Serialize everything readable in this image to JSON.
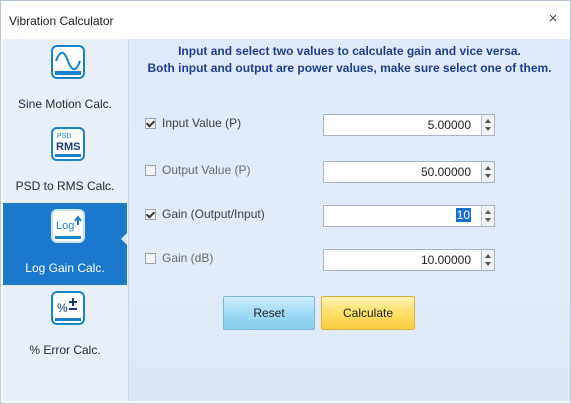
{
  "window": {
    "title": "Vibration Calculator",
    "close_glyph": "×"
  },
  "sidebar": {
    "items": [
      {
        "label": "Sine Motion Calc.",
        "icon": "sine-wave-icon",
        "active": false
      },
      {
        "label": "PSD to RMS Calc.",
        "icon": "psd-rms-icon",
        "active": false,
        "icon_text_top": "PSD",
        "icon_text_main": "RMS"
      },
      {
        "label": "Log Gain Calc.",
        "icon": "log-gain-icon",
        "active": true,
        "icon_text_main": "Log"
      },
      {
        "label": "% Error Calc.",
        "icon": "percent-error-icon",
        "active": false,
        "icon_text_main": "%"
      }
    ]
  },
  "main": {
    "header_line1": "Input and select two values to calculate gain and vice versa.",
    "header_line2": "Both input and output are power values, make sure select one of them.",
    "fields": [
      {
        "label": "Input Value (P)",
        "checked": true,
        "value": "5.00000"
      },
      {
        "label": "Output Value (P)",
        "checked": false,
        "value": "50.00000"
      },
      {
        "label": "Gain (Output/Input)",
        "checked": true,
        "value": "10"
      },
      {
        "label": "Gain (dB)",
        "checked": false,
        "value": "10.00000"
      }
    ],
    "buttons": {
      "reset": "Reset",
      "calculate": "Calculate"
    }
  },
  "colors": {
    "accent": "#1c78cc",
    "sidebar_bg": "#e7f0fb",
    "main_bg": "#dfeafa",
    "header_text": "#1e3f8f",
    "reset_btn": "#9fdbf6",
    "calc_btn": "#ffdd62"
  }
}
